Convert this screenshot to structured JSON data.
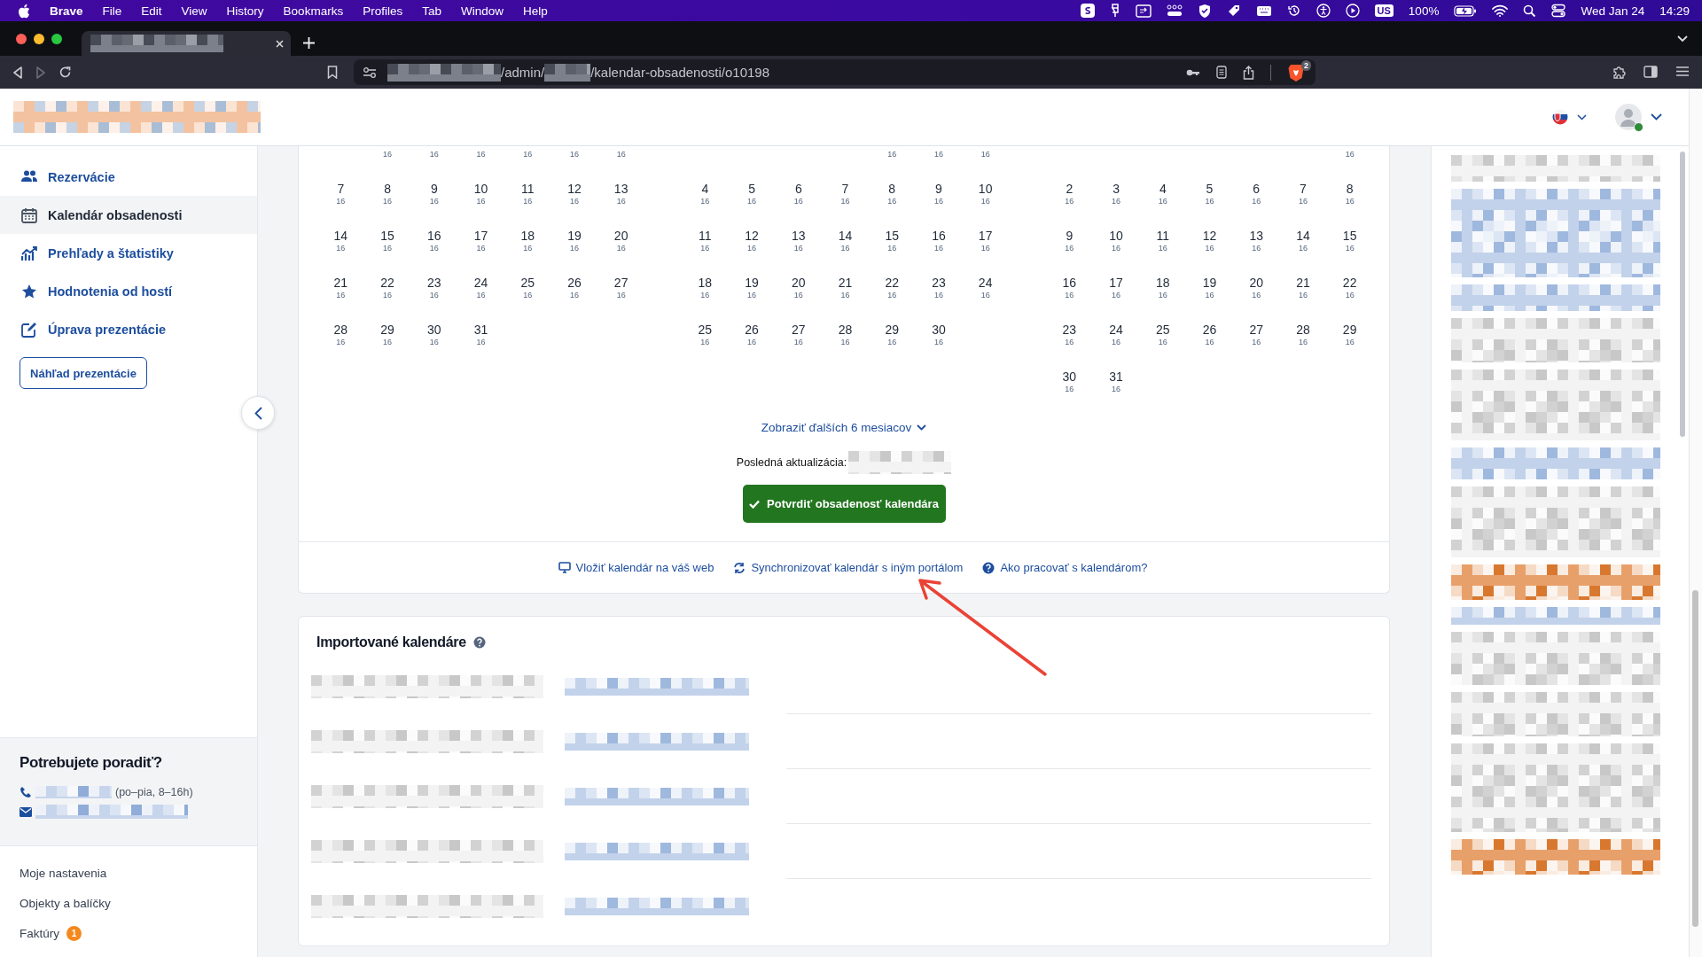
{
  "menubar": {
    "app": "Brave",
    "menus": [
      "File",
      "Edit",
      "View",
      "History",
      "Bookmarks",
      "Profiles",
      "Tab",
      "Window",
      "Help"
    ],
    "input_source": "US",
    "battery": "100%",
    "date": "Wed Jan 24",
    "time": "14:29"
  },
  "browser": {
    "tabs": [
      {
        "title": {
          "kind": "redacted"
        },
        "selected": true
      }
    ],
    "forward_disabled": true,
    "address": [
      {
        "kind": "redacted"
      },
      {
        "kind": "text",
        "text": "/admin/"
      },
      {
        "kind": "redacted"
      },
      {
        "kind": "text",
        "text": "/kalendar-obsadenosti/o10198"
      }
    ],
    "shield_count": "2"
  },
  "header": {
    "logo": {
      "kind": "redacted"
    },
    "user_online": true
  },
  "sidebar": {
    "items": [
      {
        "label": "Rezervácie",
        "kind": "people",
        "selected": false
      },
      {
        "label": "Kalendár obsadenosti",
        "kind": "calendar",
        "selected": true
      },
      {
        "label": "Prehľady a štatistiky",
        "kind": "chart",
        "selected": false
      },
      {
        "label": "Hodnotenia od hostí",
        "kind": "star",
        "selected": false
      },
      {
        "label": "Úprava prezentácie",
        "kind": "edit",
        "selected": false
      }
    ],
    "preview_button": "Náhľad prezentácie",
    "help": {
      "title": "Potrebujete poradiť?",
      "phone": [
        {
          "kind": "redacted"
        },
        {
          "kind": "text",
          "text": "(po–pia, 8–16h)"
        }
      ],
      "email": [
        {
          "kind": "redacted"
        }
      ]
    },
    "links": [
      {
        "label": "Moje nastavenia"
      },
      {
        "label": "Objekty a balíčky"
      },
      {
        "label": "Faktúry",
        "badge": "1"
      }
    ]
  },
  "calendar": {
    "months": [
      {
        "weeks": [
          [
            {
              "kind": "blank"
            },
            {
              "kind": "cut",
              "count": "16"
            },
            {
              "kind": "cut",
              "count": "16"
            },
            {
              "kind": "cut",
              "count": "16"
            },
            {
              "kind": "cut",
              "count": "16"
            },
            {
              "kind": "cut",
              "count": "16"
            },
            {
              "kind": "cut",
              "count": "16"
            }
          ],
          [
            {
              "kind": "day",
              "day": "7",
              "count": "16"
            },
            {
              "kind": "day",
              "day": "8",
              "count": "16"
            },
            {
              "kind": "day",
              "day": "9",
              "count": "16"
            },
            {
              "kind": "day",
              "day": "10",
              "count": "16"
            },
            {
              "kind": "day",
              "day": "11",
              "count": "16"
            },
            {
              "kind": "day",
              "day": "12",
              "count": "16"
            },
            {
              "kind": "day",
              "day": "13",
              "count": "16"
            }
          ],
          [
            {
              "kind": "day",
              "day": "14",
              "count": "16"
            },
            {
              "kind": "day",
              "day": "15",
              "count": "16"
            },
            {
              "kind": "day",
              "day": "16",
              "count": "16"
            },
            {
              "kind": "day",
              "day": "17",
              "count": "16"
            },
            {
              "kind": "day",
              "day": "18",
              "count": "16"
            },
            {
              "kind": "day",
              "day": "19",
              "count": "16"
            },
            {
              "kind": "day",
              "day": "20",
              "count": "16"
            }
          ],
          [
            {
              "kind": "day",
              "day": "21",
              "count": "16"
            },
            {
              "kind": "day",
              "day": "22",
              "count": "16"
            },
            {
              "kind": "day",
              "day": "23",
              "count": "16"
            },
            {
              "kind": "day",
              "day": "24",
              "count": "16"
            },
            {
              "kind": "day",
              "day": "25",
              "count": "16"
            },
            {
              "kind": "day",
              "day": "26",
              "count": "16"
            },
            {
              "kind": "day",
              "day": "27",
              "count": "16"
            }
          ],
          [
            {
              "kind": "day",
              "day": "28",
              "count": "16"
            },
            {
              "kind": "day",
              "day": "29",
              "count": "16"
            },
            {
              "kind": "day",
              "day": "30",
              "count": "16"
            },
            {
              "kind": "day",
              "day": "31",
              "count": "16"
            }
          ]
        ]
      },
      {
        "weeks": [
          [
            {
              "kind": "blank"
            },
            {
              "kind": "blank"
            },
            {
              "kind": "blank"
            },
            {
              "kind": "blank"
            },
            {
              "kind": "cut",
              "count": "16"
            },
            {
              "kind": "cut",
              "count": "16"
            },
            {
              "kind": "cut",
              "count": "16"
            }
          ],
          [
            {
              "kind": "day",
              "day": "4",
              "count": "16"
            },
            {
              "kind": "day",
              "day": "5",
              "count": "16"
            },
            {
              "kind": "day",
              "day": "6",
              "count": "16"
            },
            {
              "kind": "day",
              "day": "7",
              "count": "16"
            },
            {
              "kind": "day",
              "day": "8",
              "count": "16"
            },
            {
              "kind": "day",
              "day": "9",
              "count": "16"
            },
            {
              "kind": "day",
              "day": "10",
              "count": "16"
            }
          ],
          [
            {
              "kind": "day",
              "day": "11",
              "count": "16"
            },
            {
              "kind": "day",
              "day": "12",
              "count": "16"
            },
            {
              "kind": "day",
              "day": "13",
              "count": "16"
            },
            {
              "kind": "day",
              "day": "14",
              "count": "16"
            },
            {
              "kind": "day",
              "day": "15",
              "count": "16"
            },
            {
              "kind": "day",
              "day": "16",
              "count": "16"
            },
            {
              "kind": "day",
              "day": "17",
              "count": "16"
            }
          ],
          [
            {
              "kind": "day",
              "day": "18",
              "count": "16"
            },
            {
              "kind": "day",
              "day": "19",
              "count": "16"
            },
            {
              "kind": "day",
              "day": "20",
              "count": "16"
            },
            {
              "kind": "day",
              "day": "21",
              "count": "16"
            },
            {
              "kind": "day",
              "day": "22",
              "count": "16"
            },
            {
              "kind": "day",
              "day": "23",
              "count": "16"
            },
            {
              "kind": "day",
              "day": "24",
              "count": "16"
            }
          ],
          [
            {
              "kind": "day",
              "day": "25",
              "count": "16"
            },
            {
              "kind": "day",
              "day": "26",
              "count": "16"
            },
            {
              "kind": "day",
              "day": "27",
              "count": "16"
            },
            {
              "kind": "day",
              "day": "28",
              "count": "16"
            },
            {
              "kind": "day",
              "day": "29",
              "count": "16"
            },
            {
              "kind": "day",
              "day": "30",
              "count": "16"
            }
          ]
        ]
      },
      {
        "weeks": [
          [
            {
              "kind": "blank"
            },
            {
              "kind": "blank"
            },
            {
              "kind": "blank"
            },
            {
              "kind": "blank"
            },
            {
              "kind": "blank"
            },
            {
              "kind": "blank"
            },
            {
              "kind": "cut",
              "count": "16"
            }
          ],
          [
            {
              "kind": "day",
              "day": "2",
              "count": "16"
            },
            {
              "kind": "day",
              "day": "3",
              "count": "16"
            },
            {
              "kind": "day",
              "day": "4",
              "count": "16"
            },
            {
              "kind": "day",
              "day": "5",
              "count": "16"
            },
            {
              "kind": "day",
              "day": "6",
              "count": "16"
            },
            {
              "kind": "day",
              "day": "7",
              "count": "16"
            },
            {
              "kind": "day",
              "day": "8",
              "count": "16"
            }
          ],
          [
            {
              "kind": "day",
              "day": "9",
              "count": "16"
            },
            {
              "kind": "day",
              "day": "10",
              "count": "16"
            },
            {
              "kind": "day",
              "day": "11",
              "count": "16"
            },
            {
              "kind": "day",
              "day": "12",
              "count": "16"
            },
            {
              "kind": "day",
              "day": "13",
              "count": "16"
            },
            {
              "kind": "day",
              "day": "14",
              "count": "16"
            },
            {
              "kind": "day",
              "day": "15",
              "count": "16"
            }
          ],
          [
            {
              "kind": "day",
              "day": "16",
              "count": "16"
            },
            {
              "kind": "day",
              "day": "17",
              "count": "16"
            },
            {
              "kind": "day",
              "day": "18",
              "count": "16"
            },
            {
              "kind": "day",
              "day": "19",
              "count": "16"
            },
            {
              "kind": "day",
              "day": "20",
              "count": "16"
            },
            {
              "kind": "day",
              "day": "21",
              "count": "16"
            },
            {
              "kind": "day",
              "day": "22",
              "count": "16"
            }
          ],
          [
            {
              "kind": "day",
              "day": "23",
              "count": "16"
            },
            {
              "kind": "day",
              "day": "24",
              "count": "16"
            },
            {
              "kind": "day",
              "day": "25",
              "count": "16"
            },
            {
              "kind": "day",
              "day": "26",
              "count": "16"
            },
            {
              "kind": "day",
              "day": "27",
              "count": "16"
            },
            {
              "kind": "day",
              "day": "28",
              "count": "16"
            },
            {
              "kind": "day",
              "day": "29",
              "count": "16"
            }
          ],
          [
            {
              "kind": "day",
              "day": "30",
              "count": "16"
            },
            {
              "kind": "day",
              "day": "31",
              "count": "16"
            }
          ]
        ]
      }
    ],
    "more_link": "Zobraziť ďalších 6 mesiacov",
    "last_update": [
      {
        "kind": "text",
        "text": "Posledná aktualizácia:"
      },
      {
        "kind": "redacted"
      }
    ],
    "confirm_button": "Potvrdiť obsadenosť kalendára",
    "links": [
      {
        "kind": "monitor",
        "label": "Vložiť kalendár na váš web"
      },
      {
        "kind": "sync",
        "label": "Synchronizovať kalendár s iným portálom"
      },
      {
        "kind": "help",
        "label": "Ako pracovať s kalendárom?"
      }
    ]
  },
  "imported_calendars": {
    "title": "Importované kalendáre",
    "rows": [
      {
        "kind": "redacted"
      },
      {
        "kind": "redacted"
      },
      {
        "kind": "redacted"
      },
      {
        "kind": "redacted"
      },
      {
        "kind": "redacted"
      }
    ]
  },
  "right_panel": {
    "blocks": [
      {
        "kind": "redacted"
      },
      {
        "kind": "redacted"
      },
      {
        "kind": "redacted"
      },
      {
        "kind": "redacted"
      },
      {
        "kind": "redacted"
      },
      {
        "kind": "redacted"
      },
      {
        "kind": "redacted"
      },
      {
        "kind": "redacted"
      },
      {
        "kind": "redacted"
      },
      {
        "kind": "redacted"
      },
      {
        "kind": "redacted"
      },
      {
        "kind": "redacted"
      },
      {
        "kind": "redacted"
      }
    ]
  },
  "annotation": {
    "kind": "arrow",
    "color": "#ea4335"
  }
}
